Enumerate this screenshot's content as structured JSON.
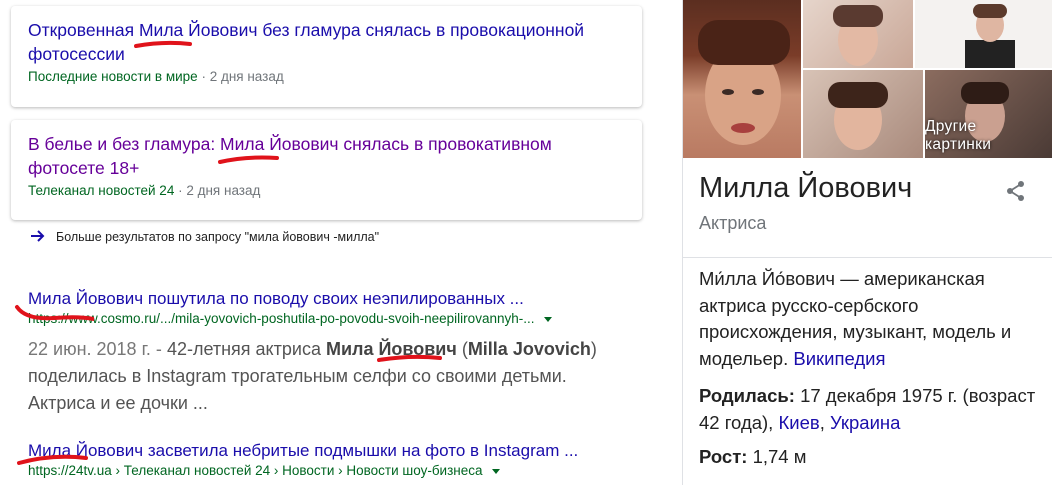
{
  "news": [
    {
      "title": "Откровенная Мила Йовович без гламура снялась в провокационной фотосессии",
      "source": "Последние новости в мире",
      "age": "2 дня назад"
    },
    {
      "title": "В белье и без гламура: Мила Йовович снялась в провокативном фотосете 18+",
      "source": "Телеканал новостей 24",
      "age": "2 дня назад"
    }
  ],
  "more_results": "Больше результатов по запросу \"мила йовович -милла\"",
  "results": [
    {
      "title": "Мила Йовович пошутила по поводу своих неэпилированных ...",
      "url": "https://www.cosmo.ru/.../mila-yovovich-poshutila-po-povodu-svoih-neepilirovannyh-...",
      "snippet_date": "22 июн. 2018 г. -",
      "snippet_pre": " 42-летняя актриса ",
      "snippet_bold1": "Мила Йовович",
      "snippet_mid": " (",
      "snippet_bold2": "Milla Jovovich",
      "snippet_post": ") поделилась в Instagram трогательным селфи со своими детьми. Актриса и ее дочки ..."
    },
    {
      "title": "Мила Йовович засветила небритые подмышки на фото в Instagram ...",
      "url": "https://24tv.ua › Телеканал новостей 24 › Новости › Новости шоу-бизнеса"
    }
  ],
  "knowledge_panel": {
    "more_images": "Другие картинки",
    "name": "Милла Йовович",
    "type": "Актриса",
    "description": "Ми́лла Йо́вович — американская актриса русско-сербского происхождения, музыкант, модель и модельер.",
    "wiki_link": "Википедия",
    "born_label": "Родилась:",
    "born_value": "17 декабря 1975 г. (возраст 42 года),",
    "born_city": "Киев",
    "born_country": "Украина",
    "height_label": "Рост:",
    "height_value": "1,74 м"
  },
  "colors": {
    "link": "#1a0dab",
    "visited": "#660099",
    "url": "#006621",
    "marker": "#e0131b"
  }
}
